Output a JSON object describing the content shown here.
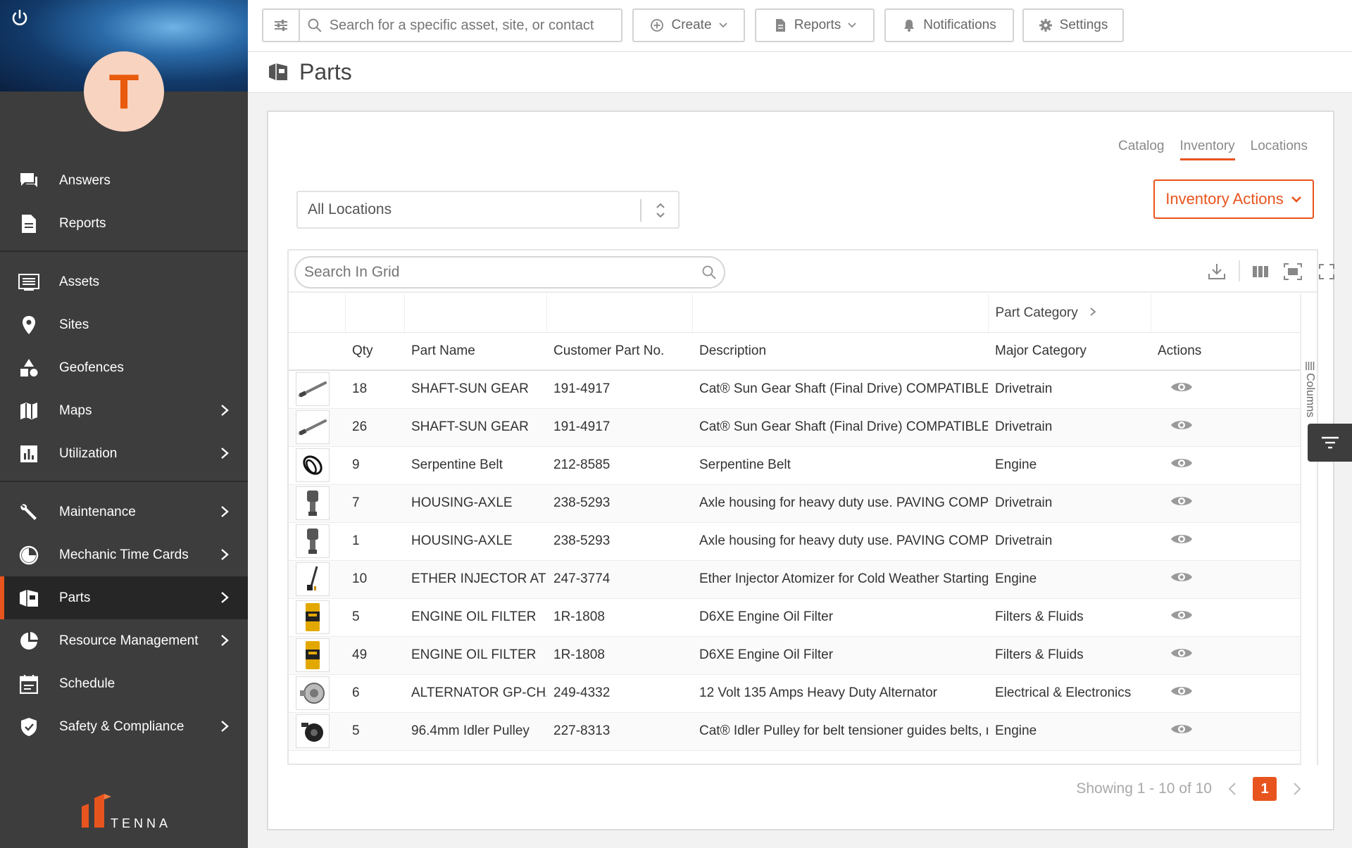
{
  "sidebar": {
    "avatar_letter": "T",
    "brand": "TENNA",
    "groups": [
      [
        {
          "label": "Answers",
          "icon": "chat-icon",
          "chevron": false
        },
        {
          "label": "Reports",
          "icon": "document-icon",
          "chevron": false
        }
      ],
      [
        {
          "label": "Assets",
          "icon": "list-icon",
          "chevron": false
        },
        {
          "label": "Sites",
          "icon": "map-pin-icon",
          "chevron": false
        },
        {
          "label": "Geofences",
          "icon": "shapes-icon",
          "chevron": false
        },
        {
          "label": "Maps",
          "icon": "map-icon",
          "chevron": true
        },
        {
          "label": "Utilization",
          "icon": "bar-chart-icon",
          "chevron": true
        }
      ],
      [
        {
          "label": "Maintenance",
          "icon": "wrench-icon",
          "chevron": true
        },
        {
          "label": "Mechanic Time Cards",
          "icon": "clock-icon",
          "chevron": true
        },
        {
          "label": "Parts",
          "icon": "box-icon",
          "chevron": true,
          "active": true
        },
        {
          "label": "Resource Management",
          "icon": "pie-chart-icon",
          "chevron": true
        },
        {
          "label": "Schedule",
          "icon": "calendar-icon",
          "chevron": false
        },
        {
          "label": "Safety & Compliance",
          "icon": "shield-icon",
          "chevron": true
        }
      ]
    ]
  },
  "topbar": {
    "search_placeholder": "Search for a specific asset, site, or contact",
    "create_label": "Create",
    "reports_label": "Reports",
    "notifications_label": "Notifications",
    "settings_label": "Settings"
  },
  "page": {
    "title": "Parts",
    "tabs": [
      "Catalog",
      "Inventory",
      "Locations"
    ],
    "active_tab": "Inventory",
    "inventory_actions_label": "Inventory Actions",
    "location_select_value": "All Locations"
  },
  "grid": {
    "search_placeholder": "Search In Grid",
    "group_header": "Part Category",
    "columns": [
      "Qty",
      "Part Name",
      "Customer Part No.",
      "Description",
      "Major Category",
      "Actions"
    ],
    "columns_side_label": "Columns",
    "rows": [
      {
        "thumb": "shaft",
        "qty": "18",
        "part_name": "SHAFT-SUN GEAR",
        "part_no": "191-4917",
        "description": "Cat® Sun Gear Shaft (Final Drive) COMPATIBLE MODELS",
        "category": "Drivetrain"
      },
      {
        "thumb": "shaft",
        "qty": "26",
        "part_name": "SHAFT-SUN GEAR",
        "part_no": "191-4917",
        "description": "Cat® Sun Gear Shaft (Final Drive) COMPATIBLE MODELS",
        "category": "Drivetrain"
      },
      {
        "thumb": "belt",
        "qty": "9",
        "part_name": "Serpentine Belt",
        "part_no": "212-8585",
        "description": "Serpentine Belt",
        "category": "Engine"
      },
      {
        "thumb": "housing",
        "qty": "7",
        "part_name": "HOUSING-AXLE",
        "part_no": "238-5293",
        "description": "Axle housing for heavy duty use. PAVING COMPATIBLE",
        "category": "Drivetrain"
      },
      {
        "thumb": "housing",
        "qty": "1",
        "part_name": "HOUSING-AXLE",
        "part_no": "238-5293",
        "description": "Axle housing for heavy duty use. PAVING COMPATIBLE",
        "category": "Drivetrain"
      },
      {
        "thumb": "injector",
        "qty": "10",
        "part_name": "ETHER INJECTOR ATOMIZER",
        "part_no": "247-3774",
        "description": "Ether Injector Atomizer for Cold Weather Starting",
        "category": "Engine"
      },
      {
        "thumb": "filter",
        "qty": "5",
        "part_name": "ENGINE OIL FILTER",
        "part_no": "1R-1808",
        "description": "D6XE Engine Oil Filter",
        "category": "Filters & Fluids"
      },
      {
        "thumb": "filter",
        "qty": "49",
        "part_name": "ENGINE OIL FILTER",
        "part_no": "1R-1808",
        "description": "D6XE Engine Oil Filter",
        "category": "Filters & Fluids"
      },
      {
        "thumb": "alternator",
        "qty": "6",
        "part_name": "ALTERNATOR GP-CHARGING",
        "part_no": "249-4332",
        "description": "12 Volt 135 Amps Heavy Duty Alternator",
        "category": "Electrical & Electronics"
      },
      {
        "thumb": "pulley",
        "qty": "5",
        "part_name": "96.4mm Idler Pulley",
        "part_no": "227-8313",
        "description": "Cat® Idler Pulley for belt tensioner guides belts, reducing wear",
        "category": "Engine"
      }
    ]
  },
  "pager": {
    "showing": "Showing 1 - 10 of 10",
    "current_page": "1"
  },
  "colors": {
    "accent": "#e8541e",
    "sidebar_bg": "#3d3d3d"
  }
}
